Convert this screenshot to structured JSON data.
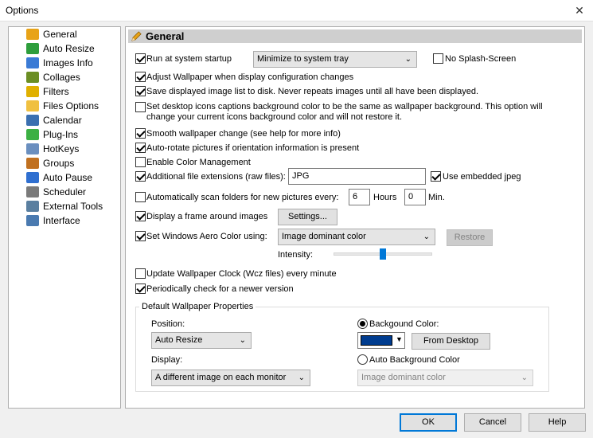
{
  "window": {
    "title": "Options",
    "close_glyph": "✕"
  },
  "sidebar": {
    "items": [
      {
        "label": "General",
        "icon": "pencil-icon",
        "color": "#e8a317",
        "selected": true
      },
      {
        "label": "Auto Resize",
        "icon": "resize-icon",
        "color": "#2e9e3c"
      },
      {
        "label": "Images Info",
        "icon": "images-info-icon",
        "color": "#3a7bd5"
      },
      {
        "label": "Collages",
        "icon": "collage-icon",
        "color": "#6b8e23"
      },
      {
        "label": "Filters",
        "icon": "filter-icon",
        "color": "#e0b000"
      },
      {
        "label": "Files Options",
        "icon": "files-icon",
        "color": "#f0c040"
      },
      {
        "label": "Calendar",
        "icon": "calendar-icon",
        "color": "#3a6fb0"
      },
      {
        "label": "Plug-Ins",
        "icon": "puzzle-icon",
        "color": "#3cb043"
      },
      {
        "label": "HotKeys",
        "icon": "keyboard-icon",
        "color": "#6a8fbf"
      },
      {
        "label": "Groups",
        "icon": "groups-icon",
        "color": "#c07020"
      },
      {
        "label": "Auto Pause",
        "icon": "pause-icon",
        "color": "#2f6fd0"
      },
      {
        "label": "Scheduler",
        "icon": "clock-icon",
        "color": "#7a7a7a"
      },
      {
        "label": "External Tools",
        "icon": "wrench-icon",
        "color": "#5a7fa0"
      },
      {
        "label": "Interface",
        "icon": "interface-icon",
        "color": "#4a7ab0"
      }
    ]
  },
  "header": {
    "title": "General"
  },
  "general": {
    "run_startup": {
      "label": "Run at system startup",
      "checked": true
    },
    "startup_mode": {
      "value": "Minimize to system tray"
    },
    "no_splash": {
      "label": "No Splash-Screen",
      "checked": false
    },
    "adjust_wallpaper": {
      "label": "Adjust Wallpaper when display configuration changes",
      "checked": true
    },
    "save_displayed": {
      "label": "Save displayed image list to disk. Never repeats images until all have been displayed.",
      "checked": true
    },
    "desktop_icons": {
      "label": "Set desktop icons captions background color to be the same as wallpaper background. This option will change your current icons background color and will not restore it.",
      "checked": false
    },
    "smooth_change": {
      "label": "Smooth wallpaper change (see help for more info)",
      "checked": true
    },
    "auto_rotate": {
      "label": "Auto-rotate pictures if orientation information is present",
      "checked": true
    },
    "color_mgmt": {
      "label": "Enable Color Management",
      "checked": false
    },
    "additional_ext": {
      "label": "Additional file extensions (raw files):",
      "checked": true,
      "value": "JPG"
    },
    "embedded_jpeg": {
      "label": "Use embedded jpeg",
      "checked": true
    },
    "auto_scan": {
      "label": "Automatically scan folders for new pictures every:",
      "checked": false,
      "hours": "6",
      "hours_label": "Hours",
      "minutes": "0",
      "minutes_label": "Min."
    },
    "display_frame": {
      "label": "Display a frame around images",
      "checked": true,
      "settings_button": "Settings..."
    },
    "aero_color": {
      "label": "Set Windows Aero Color using:",
      "checked": true,
      "value": "Image dominant color",
      "restore_button": "Restore",
      "intensity_label": "Intensity:",
      "intensity": 0.5
    },
    "update_clock": {
      "label": "Update Wallpaper Clock (Wcz files) every minute",
      "checked": false
    },
    "check_version": {
      "label": "Periodically check for a newer version",
      "checked": true
    }
  },
  "defaults": {
    "title": "Default Wallpaper Properties",
    "position_label": "Position:",
    "position_value": "Auto Resize",
    "display_label": "Display:",
    "display_value": "A different image on each monitor",
    "bg_color_label": "Backgound Color:",
    "bg_color": "#003c8f",
    "from_desktop_button": "From Desktop",
    "auto_bg_label": "Auto Background Color",
    "auto_bg_value": "Image dominant color"
  },
  "footer": {
    "ok": "OK",
    "cancel": "Cancel",
    "help": "Help"
  },
  "arrow_glyph": "⌄"
}
